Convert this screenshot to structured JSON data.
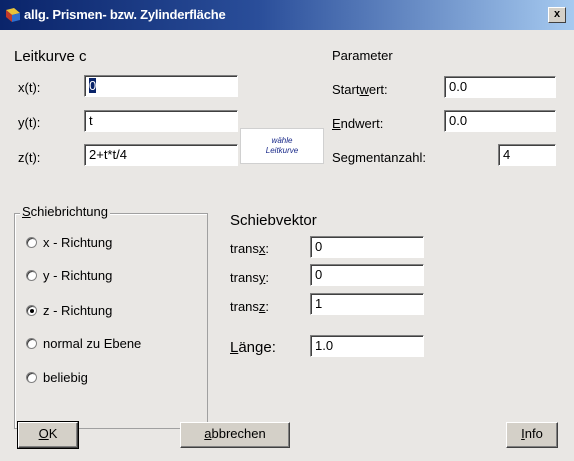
{
  "window": {
    "title": "allg. Prismen- bzw. Zylinderfläche",
    "close_label": "x"
  },
  "leitkurve": {
    "heading": "Leitkurve c",
    "x_label": "x(t):",
    "x_value": "0",
    "y_label": "y(t):",
    "y_value": "t",
    "z_label": "z(t):",
    "z_value": "2+t*t/4",
    "choose_line1": "wähle",
    "choose_line2": "Leitkurve"
  },
  "parameter": {
    "heading": "Parameter",
    "start_label_pre": "Start",
    "start_label_u": "w",
    "start_label_post": "ert:",
    "start_value": "0.0",
    "end_label_u": "E",
    "end_label_post": "ndwert:",
    "end_value": "0.0",
    "segments_label": "Segmentanzahl:",
    "segments_value": "4"
  },
  "schiebrichtung": {
    "title_u": "S",
    "title_post": "chiebrichtung",
    "options": [
      "x - Richtung",
      "y - Richtung",
      "z - Richtung",
      "normal zu Ebene",
      "beliebig"
    ],
    "selected_index": 2
  },
  "schiebvektor": {
    "heading": "Schiebvektor",
    "transx_pre": "trans",
    "transx_u": "x",
    "transx_post": ":",
    "transx_value": "0",
    "transy_pre": "trans",
    "transy_u": "y",
    "transy_post": ":",
    "transy_value": "0",
    "transz_pre": "trans",
    "transz_u": "z",
    "transz_post": ":",
    "transz_value": "1",
    "length_u": "L",
    "length_post": "änge:",
    "length_value": "1.0"
  },
  "buttons": {
    "ok_u": "O",
    "ok_post": "K",
    "cancel_u": "a",
    "cancel_post": "bbrechen",
    "info_u": "I",
    "info_post": "nfo"
  }
}
